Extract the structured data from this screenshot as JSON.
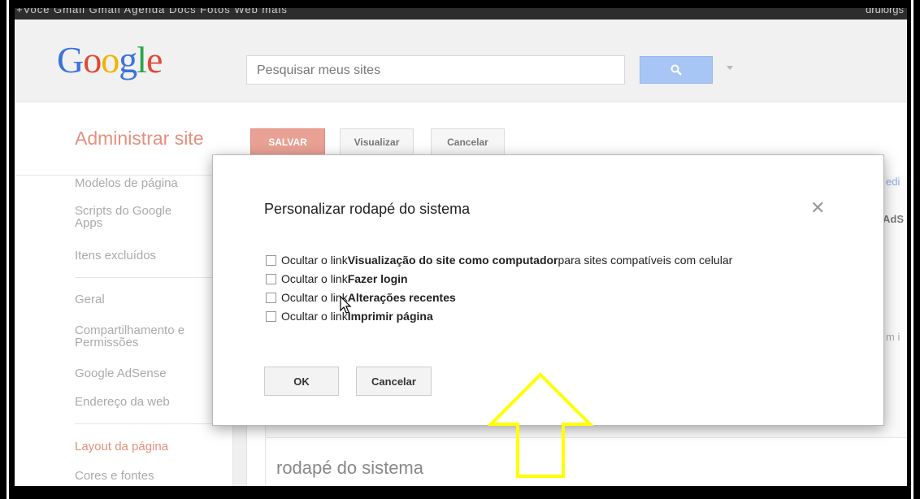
{
  "topbar": {
    "links": "+Você   Gmail   Gmail   Agenda   Docs   Fotos   Web   mais",
    "user": "drulorgs"
  },
  "header": {
    "logo": [
      "G",
      "o",
      "o",
      "g",
      "l",
      "e"
    ],
    "search_placeholder": "Pesquisar meus sites",
    "search_icon": "magnifier-icon"
  },
  "toolbar": {
    "title": "Administrar site",
    "save_label": "SALVAR",
    "view_label": "Visualizar",
    "cancel_label": "Cancelar"
  },
  "sidebar": {
    "items": [
      {
        "label": "Modelos de página"
      },
      {
        "label": "Scripts do Google Apps"
      },
      {
        "label": "Itens excluídos"
      },
      {
        "label": "Geral"
      },
      {
        "label": "Compartilhamento e Permissões"
      },
      {
        "label": "Google AdSense"
      },
      {
        "label": "Endereço da web"
      },
      {
        "label": "Layout da página"
      },
      {
        "label": "Cores e fontes"
      }
    ]
  },
  "content": {
    "footer_heading": "rodapé do sistema",
    "edge_texts": [
      "edi",
      "AdS",
      "m i"
    ]
  },
  "modal": {
    "title": "Personalizar rodapé do sistema",
    "close_icon": "close-icon",
    "options": [
      {
        "pre": "Ocultar o link ",
        "bold": "Visualização do site como computador",
        "post": " para sites compatíveis com celular",
        "checked": false
      },
      {
        "pre": "Ocultar o link ",
        "bold": "Fazer login",
        "post": "",
        "checked": false
      },
      {
        "pre": "Ocultar o link ",
        "bold": "Alterações recentes",
        "post": "",
        "checked": false
      },
      {
        "pre": "Ocultar o link ",
        "bold": "Imprimir página",
        "post": "",
        "checked": false
      }
    ],
    "ok_label": "OK",
    "cancel_label": "Cancelar"
  },
  "annotation": {
    "arrow_color": "#ffff00"
  },
  "colors": {
    "accent": "#e6907f",
    "search_button": "#a7c5f5"
  }
}
